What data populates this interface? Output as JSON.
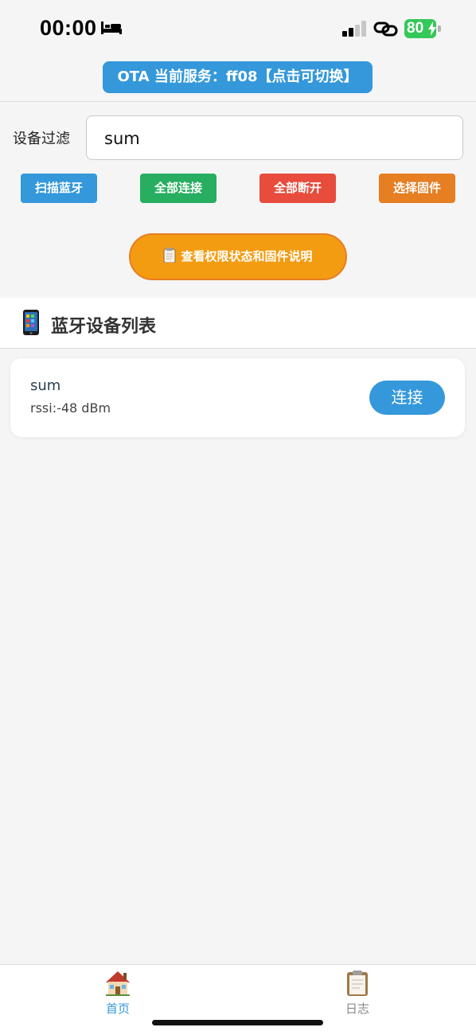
{
  "status_bar": {
    "time": "00:00",
    "battery_level": "80",
    "icons": [
      "bed-icon",
      "signal-icon",
      "link-icon",
      "battery-icon"
    ]
  },
  "ota": {
    "label": "OTA 当前服务：ff08【点击可切换】"
  },
  "filter": {
    "label": "设备过滤",
    "value": "sum"
  },
  "actions": {
    "scan": "扫描蓝牙",
    "connect_all": "全部连接",
    "disconnect_all": "全部断开",
    "select_firmware": "选择固件"
  },
  "info_button": {
    "label": "查看权限状态和固件说明",
    "icon": "clipboard-icon"
  },
  "device_list": {
    "title": "蓝牙设备列表",
    "icon": "phone-icon",
    "devices": [
      {
        "name": "sum",
        "rssi": "rssi:-48 dBm",
        "action": "连接"
      }
    ]
  },
  "tabs": [
    {
      "label": "首页",
      "icon": "house-icon",
      "active": true
    },
    {
      "label": "日志",
      "icon": "clipboard-icon",
      "active": false
    }
  ],
  "colors": {
    "primary": "#3498db",
    "success": "#27ae60",
    "danger": "#e74c3c",
    "warning": "#e67e22",
    "info_orange": "#f39c12"
  }
}
